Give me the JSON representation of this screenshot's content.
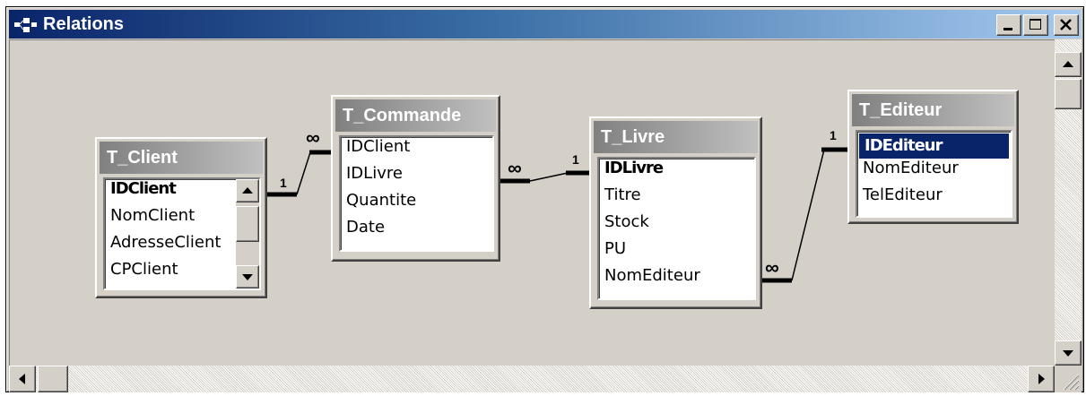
{
  "window": {
    "title": "Relations",
    "controls": {
      "minimize": "minimize-icon",
      "maximize": "maximize-icon",
      "close": "close-icon"
    }
  },
  "tables": [
    {
      "name": "T_Client",
      "fields": [
        "IDClient",
        "NomClient",
        "AdresseClient",
        "CPClient"
      ],
      "primary_key": "IDClient"
    },
    {
      "name": "T_Commande",
      "fields": [
        "IDClient",
        "IDLivre",
        "Quantite",
        "Date"
      ],
      "primary_key": null
    },
    {
      "name": "T_Livre",
      "fields": [
        "IDLivre",
        "Titre",
        "Stock",
        "PU",
        "NomEditeur"
      ],
      "primary_key": "IDLivre"
    },
    {
      "name": "T_Editeur",
      "fields": [
        "IDEditeur",
        "NomEditeur",
        "TelEditeur"
      ],
      "primary_key": "IDEditeur",
      "selected": "IDEditeur"
    }
  ],
  "relations": [
    {
      "from": "T_Client",
      "to": "T_Commande",
      "one_label": "1",
      "many_label": "∞"
    },
    {
      "from": "T_Livre",
      "to": "T_Commande",
      "one_label": "1",
      "many_label": "∞"
    },
    {
      "from": "T_Editeur",
      "to": "T_Livre",
      "one_label": "1",
      "many_label": "∞"
    }
  ],
  "colors": {
    "titlebar_active": "#0a246a",
    "titlebar_end": "#a6caf0",
    "selection": "#0a246a",
    "face": "#d4d0c8"
  }
}
